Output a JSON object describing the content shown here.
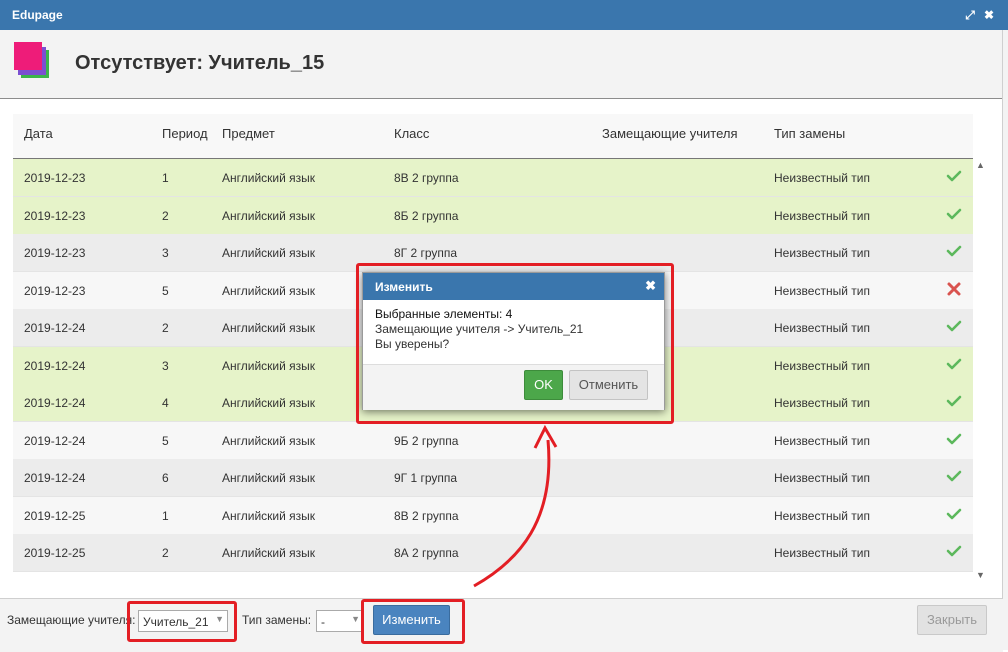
{
  "window": {
    "title": "Edupage"
  },
  "header": {
    "title": "Отсутствует: Учитель_15"
  },
  "colors": {
    "titlebar": "#3a76ad",
    "selected_row": "#e6f3c9",
    "ok_icon": "#5cb85c",
    "error_icon": "#d9534f",
    "annotation": "#e31e24"
  },
  "table": {
    "columns": [
      "Дата",
      "Период",
      "Предмет",
      "Класс",
      "Замещающие учителя",
      "Тип замены"
    ],
    "rows": [
      {
        "date": "2019-12-23",
        "period": "1",
        "subject": "Английский язык",
        "class": "8В 2 группа",
        "teachers": "",
        "type": "Неизвестный тип",
        "status": "check-icon"
      },
      {
        "date": "2019-12-23",
        "period": "2",
        "subject": "Английский язык",
        "class": "8Б 2 группа",
        "teachers": "",
        "type": "Неизвестный тип",
        "status": "check-icon"
      },
      {
        "date": "2019-12-23",
        "period": "3",
        "subject": "Английский язык",
        "class": "8Г 2 группа",
        "teachers": "",
        "type": "Неизвестный тип",
        "status": "check-icon"
      },
      {
        "date": "2019-12-23",
        "period": "5",
        "subject": "Английский язык",
        "class": "",
        "teachers": "",
        "type": "Неизвестный тип",
        "status": "cross-icon"
      },
      {
        "date": "2019-12-24",
        "period": "2",
        "subject": "Английский язык",
        "class": "",
        "teachers": "",
        "type": "Неизвестный тип",
        "status": "check-icon"
      },
      {
        "date": "2019-12-24",
        "period": "3",
        "subject": "Английский язык",
        "class": "",
        "teachers": "",
        "type": "Неизвестный тип",
        "status": "check-icon"
      },
      {
        "date": "2019-12-24",
        "period": "4",
        "subject": "Английский язык",
        "class": "",
        "teachers": "",
        "type": "Неизвестный тип",
        "status": "check-icon"
      },
      {
        "date": "2019-12-24",
        "period": "5",
        "subject": "Английский язык",
        "class": "9Б 2 группа",
        "teachers": "",
        "type": "Неизвестный тип",
        "status": "check-icon"
      },
      {
        "date": "2019-12-24",
        "period": "6",
        "subject": "Английский язык",
        "class": "9Г 1 группа",
        "teachers": "",
        "type": "Неизвестный тип",
        "status": "check-icon"
      },
      {
        "date": "2019-12-25",
        "period": "1",
        "subject": "Английский язык",
        "class": "8В 2 группа",
        "teachers": "",
        "type": "Неизвестный тип",
        "status": "check-icon"
      },
      {
        "date": "2019-12-25",
        "period": "2",
        "subject": "Английский язык",
        "class": "8А 2 группа",
        "teachers": "",
        "type": "Неизвестный тип",
        "status": "check-icon"
      }
    ]
  },
  "bottom": {
    "teachers_label": "Замещающие учителя:",
    "teachers_value": "Учитель_21",
    "type_label": "Тип замены:",
    "type_value": "-",
    "change_button": "Изменить",
    "close_button": "Закрыть"
  },
  "dialog": {
    "title": "Изменить",
    "line1": "Выбранные элементы: 4",
    "line2": "Замещающие учителя -> Учитель_21",
    "line3": "Вы уверены?",
    "ok": "OK",
    "cancel": "Отменить"
  }
}
